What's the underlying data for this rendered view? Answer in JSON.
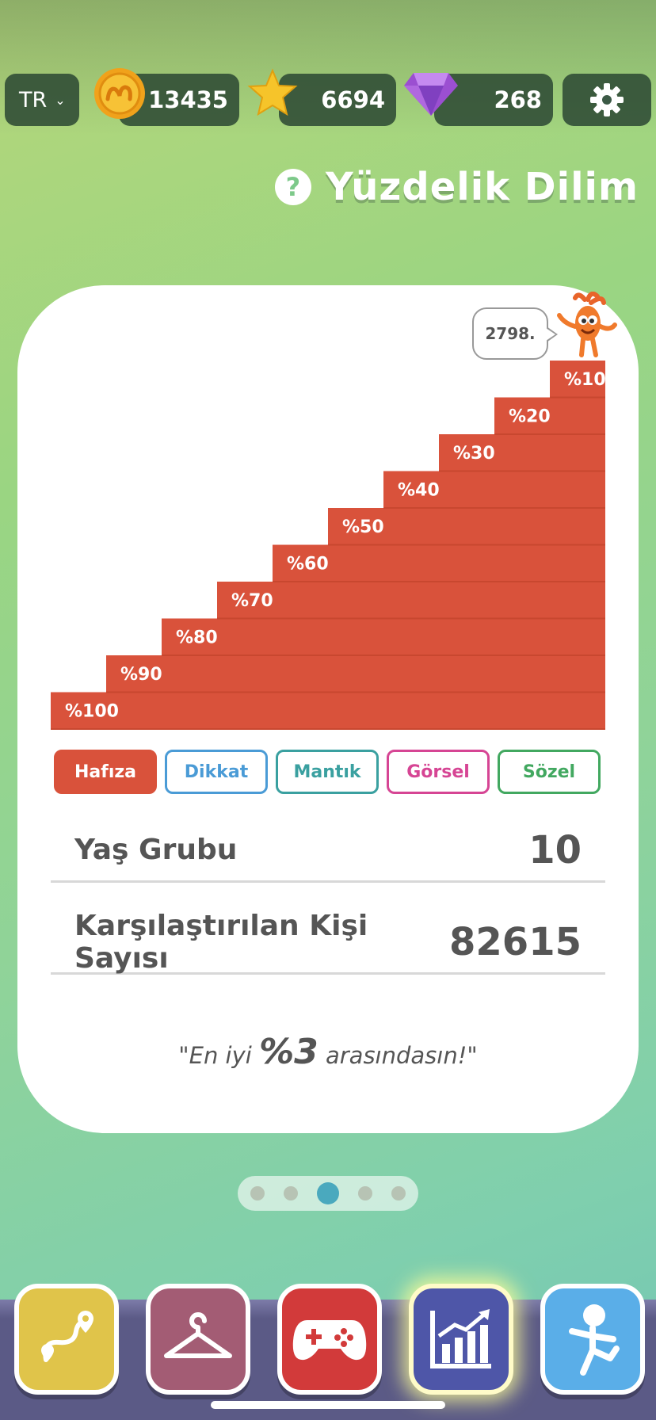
{
  "topbar": {
    "language": "TR",
    "coins": "13435",
    "stars": "6694",
    "gems": "268"
  },
  "title": "Yüzdelik Dilim",
  "rank_bubble": "2798.",
  "chart_data": {
    "type": "bar",
    "categories": [
      "%100",
      "%90",
      "%80",
      "%70",
      "%60",
      "%50",
      "%40",
      "%30",
      "%20",
      "%10"
    ],
    "values": [
      1,
      2,
      3,
      4,
      5,
      6,
      7,
      8,
      9,
      10
    ],
    "bar_color": "#d9523b"
  },
  "tabs": [
    {
      "label": "Hafıza",
      "color": "#d9523b",
      "active": true
    },
    {
      "label": "Dikkat",
      "color": "#4a9bd6",
      "active": false
    },
    {
      "label": "Mantık",
      "color": "#3aa0a0",
      "active": false
    },
    {
      "label": "Görsel",
      "color": "#d64594",
      "active": false
    },
    {
      "label": "Sözel",
      "color": "#42a860",
      "active": false
    }
  ],
  "stats": {
    "age_label": "Yaş Grubu",
    "age_value": "10",
    "count_label": "Karşılaştırılan Kişi Sayısı",
    "count_value": "82615"
  },
  "quote": {
    "prefix": "\"En iyi ",
    "highlight": "%3",
    "suffix": " arasındasın!\""
  },
  "pager": {
    "count": 5,
    "active": 3
  },
  "nav": [
    {
      "icon": "map-route-icon",
      "color": "#e0c44a"
    },
    {
      "icon": "hanger-icon",
      "color": "#a35c74"
    },
    {
      "icon": "gamepad-icon",
      "color": "#d23a3a"
    },
    {
      "icon": "chart-icon",
      "color": "#4e56a8"
    },
    {
      "icon": "avatar-icon",
      "color": "#5aaee8"
    }
  ]
}
